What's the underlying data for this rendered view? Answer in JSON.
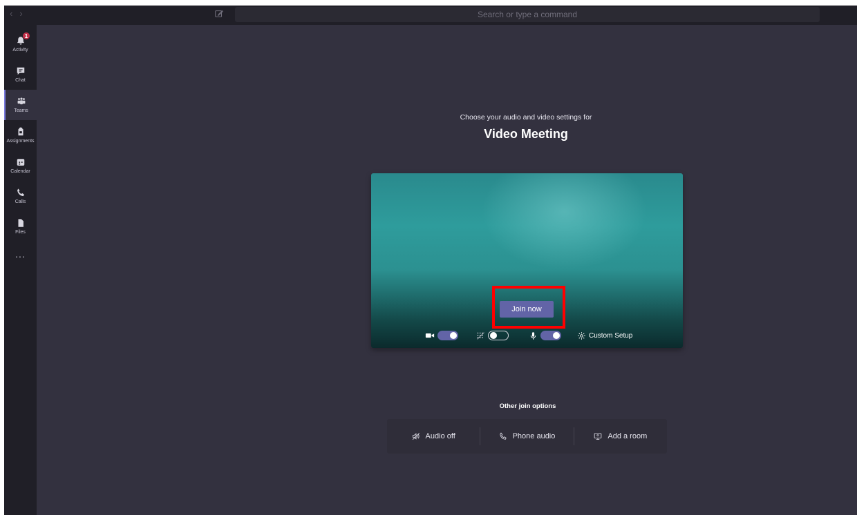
{
  "topbar": {
    "back_icon": "‹",
    "forward_icon": "›",
    "search_placeholder": "Search or type a command"
  },
  "rail": {
    "activity_badge": "1",
    "items": [
      {
        "label": "Activity",
        "icon": "bell-icon"
      },
      {
        "label": "Chat",
        "icon": "chat-icon"
      },
      {
        "label": "Teams",
        "icon": "teams-icon",
        "active": true
      },
      {
        "label": "Assignments",
        "icon": "assignments-icon"
      },
      {
        "label": "Calendar",
        "icon": "calendar-icon"
      },
      {
        "label": "Calls",
        "icon": "phone-icon"
      },
      {
        "label": "Files",
        "icon": "file-icon"
      }
    ],
    "more": "..."
  },
  "meeting": {
    "subtitle": "Choose your audio and video settings for",
    "title": "Video Meeting",
    "join_label": "Join now",
    "controls": {
      "camera_on": true,
      "blur_on": false,
      "mic_on": true,
      "custom_setup_label": "Custom Setup"
    }
  },
  "other_join": {
    "label": "Other join options",
    "options": [
      "Audio off",
      "Phone audio",
      "Add a room"
    ]
  },
  "colors": {
    "accent": "#6264a7",
    "highlight": "#ff0000",
    "background": "#33313f",
    "rail": "#201f27"
  }
}
